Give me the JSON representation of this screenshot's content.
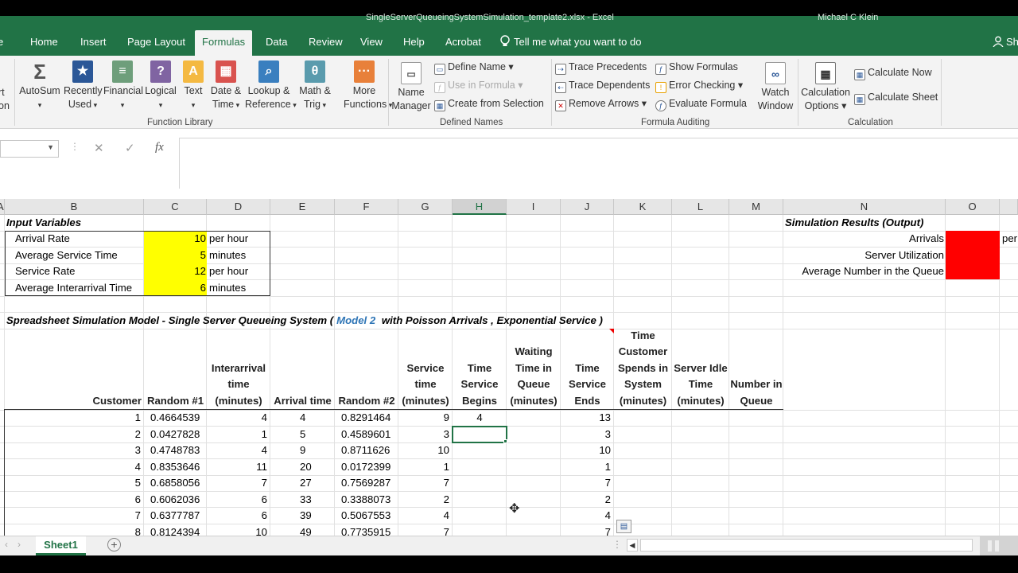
{
  "window": {
    "title": "SingleServerQueueingSystemSimulation_template2.xlsx - Excel",
    "user": "Michael C Klein"
  },
  "tabs": [
    "Home",
    "Insert",
    "Page Layout",
    "Formulas",
    "Data",
    "Review",
    "View",
    "Help",
    "Acrobat"
  ],
  "tell_me": "Tell me what you want to do",
  "share": "Sh",
  "ribbon": {
    "insert_fn_partial": [
      "rt",
      "on"
    ],
    "function_library": {
      "buttons": [
        {
          "label1": "AutoSum",
          "label2": "",
          "icon": "sigma-icon",
          "color": "#555555",
          "glyph": "Σ"
        },
        {
          "label1": "Recently",
          "label2": "Used",
          "icon": "star-book-icon",
          "color": "#2b5797",
          "glyph": "★"
        },
        {
          "label1": "Financial",
          "label2": "",
          "icon": "financial-book-icon",
          "color": "#6e9e7b",
          "glyph": "≡"
        },
        {
          "label1": "Logical",
          "label2": "",
          "icon": "logical-book-icon",
          "color": "#8064a2",
          "glyph": "?"
        },
        {
          "label1": "Text",
          "label2": "",
          "icon": "text-book-icon",
          "color": "#f4b942",
          "glyph": "A"
        },
        {
          "label1": "Date &",
          "label2": "Time",
          "icon": "calendar-book-icon",
          "color": "#d9534f",
          "glyph": "▦"
        },
        {
          "label1": "Lookup &",
          "label2": "Reference",
          "icon": "lookup-book-icon",
          "color": "#3a7fbf",
          "glyph": "⌕"
        },
        {
          "label1": "Math &",
          "label2": "Trig",
          "icon": "math-book-icon",
          "color": "#5a9bad",
          "glyph": "θ"
        },
        {
          "label1": "More",
          "label2": "Functions",
          "icon": "more-functions-icon",
          "color": "#e8803a",
          "glyph": "···"
        }
      ],
      "group_label": "Function Library"
    },
    "defined_names": {
      "name_manager1": "Name",
      "name_manager2": "Manager",
      "define_name": "Define Name",
      "use_in_formula": "Use in Formula",
      "create_from_selection": "Create from Selection",
      "group_label": "Defined Names"
    },
    "formula_auditing": {
      "trace_precedents": "Trace Precedents",
      "trace_dependents": "Trace Dependents",
      "remove_arrows": "Remove Arrows",
      "show_formulas": "Show Formulas",
      "error_checking": "Error Checking",
      "evaluate_formula": "Evaluate Formula",
      "watch1": "Watch",
      "watch2": "Window",
      "group_label": "Formula Auditing"
    },
    "calculation": {
      "options1": "Calculation",
      "options2": "Options",
      "calc_now": "Calculate Now",
      "calc_sheet": "Calculate Sheet",
      "group_label": "Calculation"
    }
  },
  "formula_bar": {
    "cancel": "✕",
    "enter": "✓",
    "fx": "fx",
    "content": ""
  },
  "columns": [
    "A",
    "B",
    "C",
    "D",
    "E",
    "F",
    "G",
    "H",
    "I",
    "J",
    "K",
    "L",
    "M",
    "N",
    "O"
  ],
  "selected_column": "H",
  "inputs": {
    "title": "Input Variables",
    "rows": [
      {
        "label": "Arrival Rate",
        "value": "10",
        "unit": "per hour"
      },
      {
        "label": "Average Service Time",
        "value": "5",
        "unit": "minutes"
      },
      {
        "label": "Service Rate",
        "value": "12",
        "unit": "per hour"
      },
      {
        "label": "Average Interarrival Time",
        "value": "6",
        "unit": "minutes"
      }
    ]
  },
  "results": {
    "title": "Simulation Results (Output)",
    "rows": [
      {
        "label": "Arrivals",
        "unit": "per"
      },
      {
        "label": "Server Utilization",
        "unit": ""
      },
      {
        "label": "Average Number in the Queue",
        "unit": ""
      }
    ]
  },
  "model_title": {
    "pre": "Spreadsheet Simulation Model - Single Server Queueing System (",
    "model": "Model 2",
    "post": " with Poisson Arrivals , Exponential Service )"
  },
  "table_headers": [
    "Customer",
    "Random #1",
    "Interarrival time (minutes)",
    "Arrival time",
    "Random #2",
    "Service time (minutes)",
    "Time Service Begins",
    "Waiting Time in Queue (minutes)",
    "Time Service Ends",
    "Time Customer Spends in System (minutes)",
    "Server Idle Time (minutes)",
    "Number in Queue"
  ],
  "table_rows": [
    [
      "1",
      "0.4664539",
      "4",
      "4",
      "0.8291464",
      "9",
      "4",
      "",
      "13"
    ],
    [
      "2",
      "0.0427828",
      "1",
      "5",
      "0.4589601",
      "3",
      "",
      "",
      "3"
    ],
    [
      "3",
      "0.4748783",
      "4",
      "9",
      "0.8711626",
      "10",
      "",
      "",
      "10"
    ],
    [
      "4",
      "0.8353646",
      "11",
      "20",
      "0.0172399",
      "1",
      "",
      "",
      "1"
    ],
    [
      "5",
      "0.6858056",
      "7",
      "27",
      "0.7569287",
      "7",
      "",
      "",
      "7"
    ],
    [
      "6",
      "0.6062036",
      "6",
      "33",
      "0.3388073",
      "2",
      "",
      "",
      "2"
    ],
    [
      "7",
      "0.6377787",
      "6",
      "39",
      "0.5067553",
      "4",
      "",
      "",
      "4"
    ],
    [
      "8",
      "0.8124394",
      "10",
      "49",
      "0.7735915",
      "7",
      "",
      "",
      "7"
    ]
  ],
  "sheet_tab": "Sheet1",
  "colors": {
    "excel_green": "#217346",
    "input_fill": "#ffff00",
    "output_fill": "#ff0000",
    "model_blue": "#2e75b6"
  }
}
